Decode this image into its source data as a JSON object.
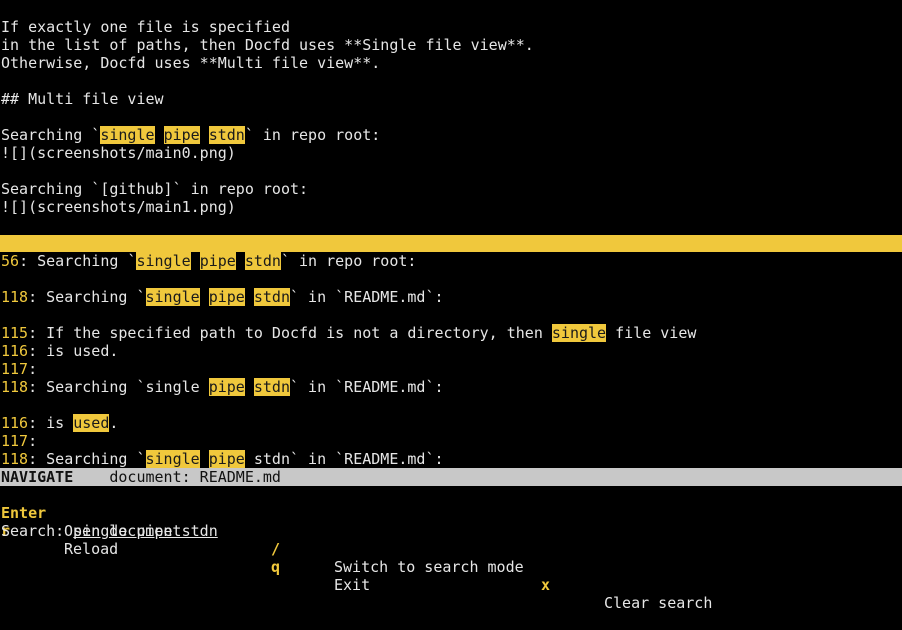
{
  "preview": {
    "l1": "If exactly one file is specified",
    "l2": "in the list of paths, then Docfd uses **Single file view**.",
    "l3": "Otherwise, Docfd uses **Multi file view**.",
    "l4": "## Multi file view",
    "l5_pre": "Searching `",
    "l5_w1": "single",
    "l5_w2": "pipe",
    "l5_w3": "stdn",
    "l5_post": "` in repo root:",
    "l6": "![](screenshots/main0.png)",
    "l7": "Searching `[github]` in repo root:",
    "l8": "![](screenshots/main1.png)"
  },
  "results": {
    "r1_ln": "56",
    "r1_pre": ": Searching `",
    "r1_w1": "single",
    "r1_w2": "pipe",
    "r1_w3": "stdn",
    "r1_post": "` in repo root:",
    "r2_ln": "118",
    "r2_pre": ": Searching `",
    "r2_w1": "single",
    "r2_w2": "pipe",
    "r2_w3": "stdn",
    "r2_post": "` in `README.md`:",
    "r3a_ln": "115",
    "r3a_pre": ": If the specified path to Docfd is not a directory, then ",
    "r3a_w1": "single",
    "r3a_post": " file view",
    "r3b_ln": "116",
    "r3b_text": ": is used.",
    "r3c_ln": "117",
    "r3c_text": ":",
    "r3d_ln": "118",
    "r3d_pre": ": Searching `single ",
    "r3d_w1": "pipe",
    "r3d_w2": "stdn",
    "r3d_post": "` in `README.md`:",
    "r4a_ln": "116",
    "r4a_pre": ": is ",
    "r4a_w1": "used",
    "r4a_post": ".",
    "r4b_ln": "117",
    "r4b_text": ":",
    "r4c_ln": "118",
    "r4c_pre": ": Searching `",
    "r4c_w1": "single",
    "r4c_w2": "pipe",
    "r4c_post": " stdn` in `README.md`:"
  },
  "status": {
    "mode": "NAVIGATE",
    "document_label": "document: README.md"
  },
  "keys": {
    "enter_key": "Enter",
    "enter_desc": "Open document",
    "slash_key": "/",
    "slash_desc": "Switch to search mode",
    "x_key": "x",
    "x_desc": "Clear search",
    "r_key": "r",
    "r_desc": "Reload",
    "q_key": "q",
    "q_desc": "Exit"
  },
  "search": {
    "label": "Search: ",
    "value": "single pipe stdn"
  },
  "colors": {
    "highlight": "#f0c83c",
    "status_bar": "#c8c8c8",
    "background": "#000000"
  }
}
